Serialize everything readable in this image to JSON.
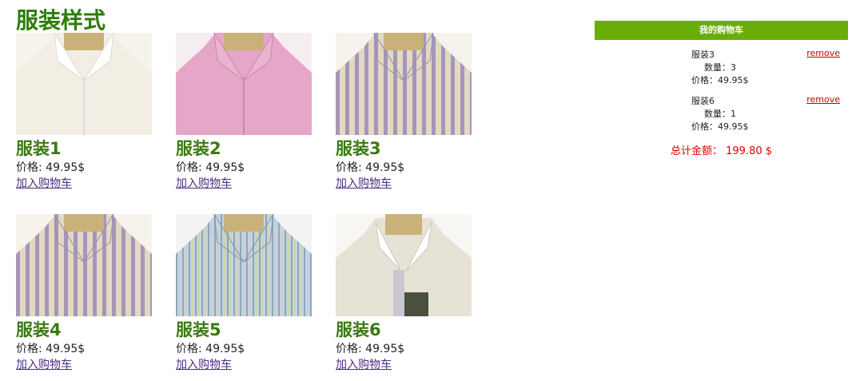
{
  "page": {
    "title": "服装样式"
  },
  "products": [
    {
      "name": "服装1",
      "price": "价格: 49.95$",
      "add_label": "加入购物车",
      "shirt_color": "#f3eee4"
    },
    {
      "name": "服装2",
      "price": "价格: 49.95$",
      "add_label": "加入购物车",
      "shirt_color": "#e6a6c8"
    },
    {
      "name": "服装3",
      "price": "价格: 49.95$",
      "add_label": "加入购物车",
      "shirt_color": "#d8cdbd"
    },
    {
      "name": "服装4",
      "price": "价格: 49.95$",
      "add_label": "加入购物车",
      "shirt_color": "#d8cdbd"
    },
    {
      "name": "服装5",
      "price": "价格: 49.95$",
      "add_label": "加入购物车",
      "shirt_color": "#b9c9d6"
    },
    {
      "name": "服装6",
      "price": "价格: 49.95$",
      "add_label": "加入购物车",
      "shirt_color": "#e7e2d6"
    }
  ],
  "cart": {
    "title": "我的购物车",
    "items": [
      {
        "name": "服装3",
        "qty": "数量：3",
        "price": "价格：49.95$",
        "remove_label": "remove"
      },
      {
        "name": "服装6",
        "qty": "数量：1",
        "price": "价格：49.95$",
        "remove_label": "remove"
      }
    ],
    "total_label": "总计金额：",
    "total_value": "199.80 $"
  },
  "colors": {
    "accent": "#6aad0a",
    "title": "#2e7d0a",
    "total": "#e00000",
    "link": "#4b2e83"
  }
}
